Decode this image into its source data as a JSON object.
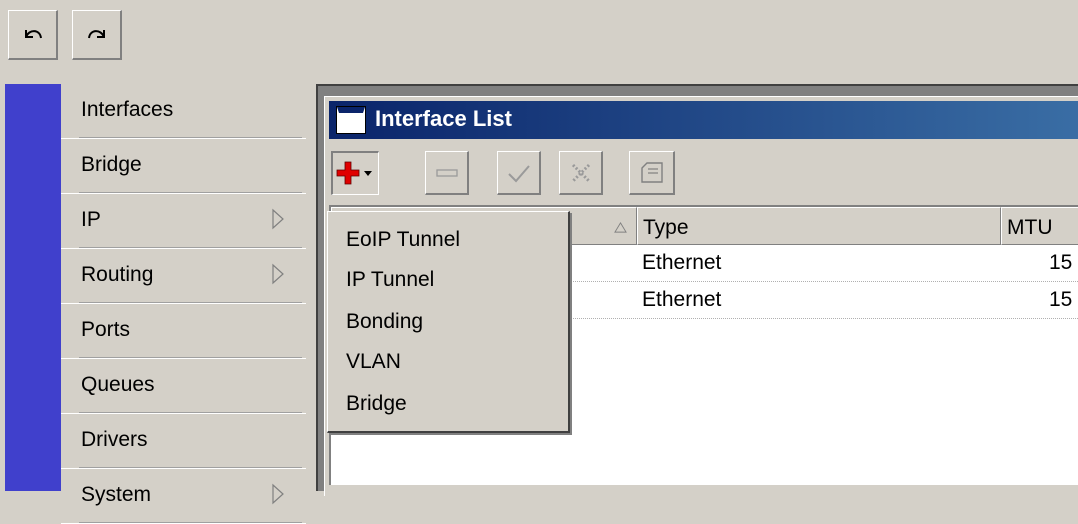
{
  "top_toolbar": {
    "undo_icon": "undo-icon",
    "redo_icon": "redo-icon"
  },
  "sidebar": {
    "items": [
      {
        "label": "Interfaces",
        "has_submenu": false
      },
      {
        "label": "Bridge",
        "has_submenu": false
      },
      {
        "label": "IP",
        "has_submenu": true
      },
      {
        "label": "Routing",
        "has_submenu": true
      },
      {
        "label": "Ports",
        "has_submenu": false
      },
      {
        "label": "Queues",
        "has_submenu": false
      },
      {
        "label": "Drivers",
        "has_submenu": false
      },
      {
        "label": "System",
        "has_submenu": true
      }
    ]
  },
  "window": {
    "title": "Interface List",
    "toolbar": {
      "add_icon": "add-icon",
      "remove_icon": "minus-icon",
      "enable_icon": "check-icon",
      "disable_icon": "x-icon",
      "comment_icon": "comment-icon"
    }
  },
  "add_menu": {
    "items": [
      "EoIP Tunnel",
      "IP Tunnel",
      "Bonding",
      "VLAN",
      "Bridge"
    ]
  },
  "table": {
    "columns": [
      "Type",
      "MTU"
    ],
    "rows": [
      {
        "type": "Ethernet",
        "mtu": "15"
      },
      {
        "type": "Ethernet",
        "mtu": "15"
      }
    ]
  },
  "colors": {
    "nav_stripe": "#4040cc",
    "title_bar": "#0a246a",
    "add_icon": "#e00000"
  }
}
